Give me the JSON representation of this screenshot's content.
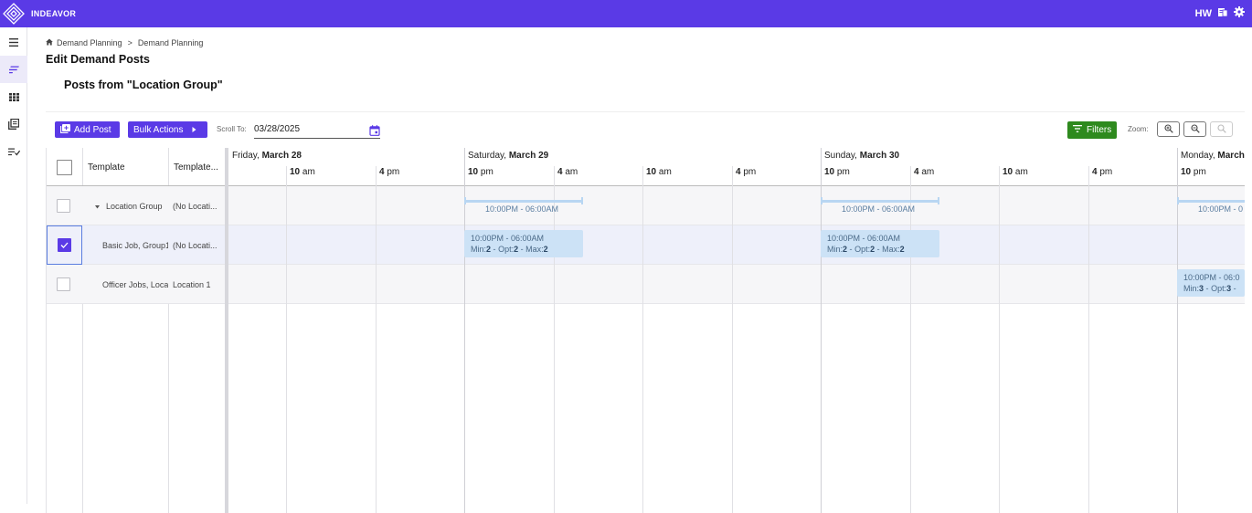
{
  "app": {
    "brand": "INDEAVOR",
    "user_initials": "HW"
  },
  "icons": {
    "logo": "diamond-logo-icon",
    "docs": "document-icon",
    "settings": "gear-icon",
    "menu": "hamburger-icon",
    "home": "home-icon",
    "calendar": "calendar-icon",
    "zoom_in": "zoom-in-icon",
    "zoom_out": "zoom-out-icon",
    "zoom_reset": "zoom-reset-icon"
  },
  "nav": [
    {
      "name": "menu",
      "icon": "hamburger-icon"
    },
    {
      "name": "demand-planning",
      "icon": "list-lines-icon",
      "active": true
    },
    {
      "name": "grid",
      "icon": "grid-icon"
    },
    {
      "name": "library",
      "icon": "library-icon"
    },
    {
      "name": "checklist",
      "icon": "checklist-icon"
    }
  ],
  "breadcrumb": {
    "items": [
      "Demand Planning",
      "Demand Planning"
    ],
    "separator": ">"
  },
  "page": {
    "title": "Edit Demand Posts",
    "section_title": "Posts from \"Location Group\""
  },
  "toolbar": {
    "add_post": "Add Post",
    "bulk_actions": "Bulk Actions",
    "scroll_to_label": "Scroll To:",
    "scroll_to_value": "03/28/2025",
    "filters": "Filters",
    "zoom_label": "Zoom:"
  },
  "table": {
    "columns": [
      "Template",
      "Template..."
    ],
    "rows": [
      {
        "name": "Location Group",
        "template": "(No Locati...",
        "expanded": true,
        "checked": false
      },
      {
        "name": "Basic Job, Group1",
        "template": "(No Locati...",
        "checked": true
      },
      {
        "name": "Officer Jobs, Loca",
        "template": "Location 1",
        "checked": false
      }
    ]
  },
  "timeline": {
    "days": [
      {
        "weekday": "Friday,",
        "date": "March 28"
      },
      {
        "weekday": "Saturday,",
        "date": "March 29"
      },
      {
        "weekday": "Sunday,",
        "date": "March 30"
      },
      {
        "weekday": "Monday,",
        "date": "March"
      }
    ],
    "ticks": [
      {
        "hour": "10",
        "suffix": "am"
      },
      {
        "hour": "4",
        "suffix": "pm"
      },
      {
        "hour": "10",
        "suffix": "pm"
      },
      {
        "hour": "4",
        "suffix": "am"
      },
      {
        "hour": "10",
        "suffix": "am"
      },
      {
        "hour": "4",
        "suffix": "pm"
      },
      {
        "hour": "10",
        "suffix": "pm"
      },
      {
        "hour": "4",
        "suffix": "am"
      },
      {
        "hour": "10",
        "suffix": "am"
      },
      {
        "hour": "4",
        "suffix": "pm"
      },
      {
        "hour": "10",
        "suffix": "pm"
      }
    ],
    "group_summaries": [
      "10:00PM - 06:00AM",
      "10:00PM - 06:00AM",
      "10:00PM - 0"
    ],
    "events": [
      {
        "time": "10:00PM - 06:00AM",
        "min": "2",
        "opt": "2",
        "max": "2"
      },
      {
        "time": "10:00PM - 06:00AM",
        "min": "2",
        "opt": "2",
        "max": "2"
      },
      {
        "time": "10:00PM - 06:0",
        "min": "3",
        "opt": "3",
        "max": ""
      }
    ],
    "labels": {
      "min": "Min:",
      "opt": "Opt:",
      "max": "Max:",
      "sep": "-"
    }
  },
  "colors": {
    "brand": "#5a3ae6",
    "filters": "#2e8a1e",
    "event": "#cce2f6"
  }
}
